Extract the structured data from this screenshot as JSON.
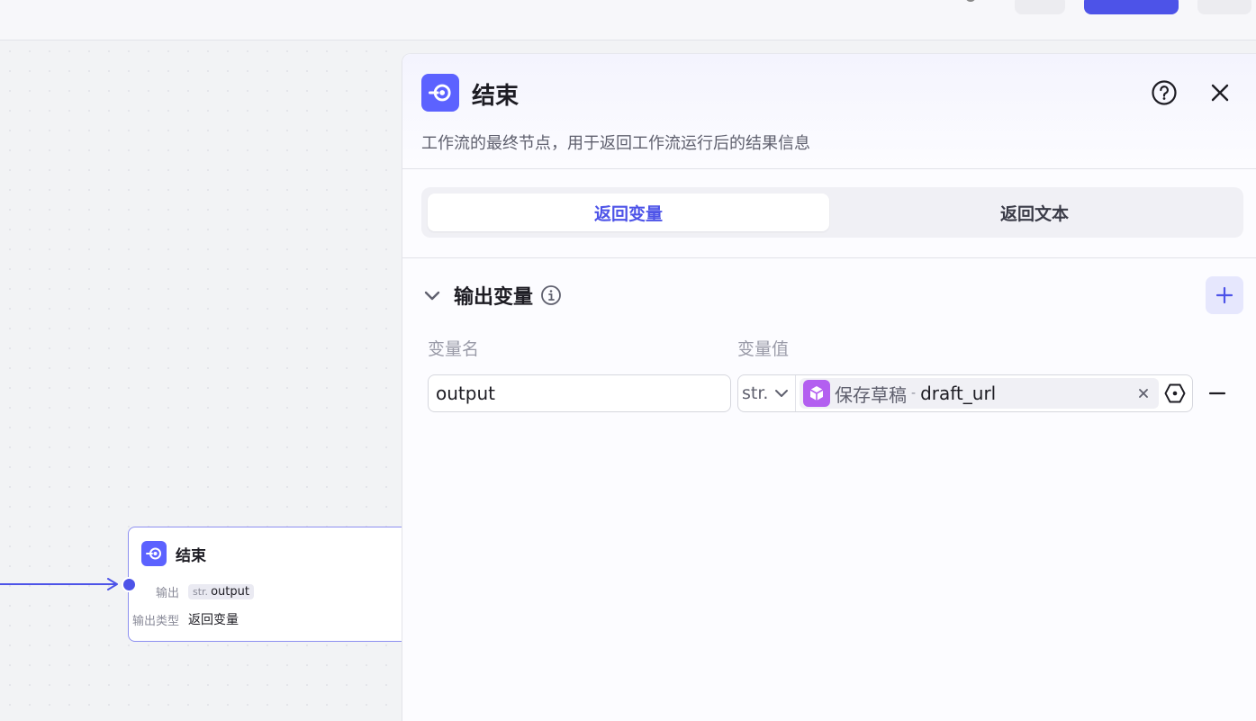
{
  "node": {
    "title": "结束",
    "output_label": "输出",
    "output_type_prefix": "str.",
    "output_name": "output",
    "output_type_label": "输出类型",
    "output_type_value": "返回变量"
  },
  "panel": {
    "title": "结束",
    "description": "工作流的最终节点，用于返回工作流运行后的结果信息",
    "tabs": [
      {
        "label": "返回变量",
        "active": true
      },
      {
        "label": "返回文本",
        "active": false
      }
    ],
    "section_title": "输出变量",
    "columns": {
      "name": "变量名",
      "value": "变量值"
    },
    "rows": [
      {
        "name": "output",
        "type": "str.",
        "ref_node": "保存草稿",
        "ref_separator": "-",
        "ref_var": "draft_url"
      }
    ]
  },
  "colors": {
    "accent": "#4d53e8",
    "node_icon": "#5c62ff",
    "ref_icon": "#b35ff0"
  },
  "icons": {
    "end_node": "end-icon",
    "help": "help-icon",
    "close": "close-icon",
    "collapse": "chevron-down-icon",
    "info": "info-icon",
    "add": "plus-icon",
    "ref_node": "cube-icon",
    "clear": "clear-icon",
    "target": "variable-target-icon",
    "remove": "minus-icon"
  }
}
